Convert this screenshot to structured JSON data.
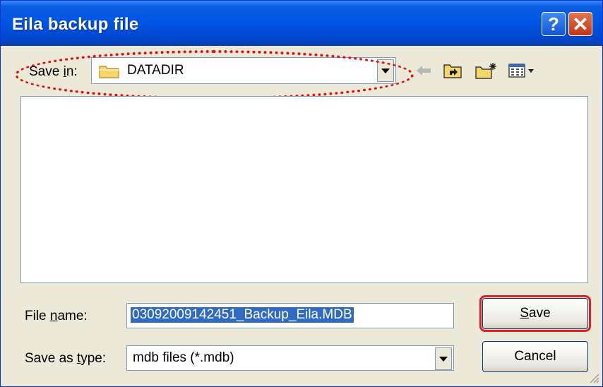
{
  "window": {
    "title": "Eila backup file",
    "help_label": "?",
    "close_label": "✕",
    "colors": {
      "titlebar": "#0055e5",
      "dialog": "#ece9d8",
      "highlight": "#e01010"
    }
  },
  "save_in": {
    "label_prefix": "Save ",
    "label_underline": "i",
    "label_suffix": "n:",
    "value": "DATADIR",
    "icon": "folder-icon"
  },
  "toolbar": {
    "items": [
      "back-arrow-icon",
      "up-folder-icon",
      "new-folder-icon",
      "view-menu-icon"
    ]
  },
  "file_name": {
    "label_prefix": "File ",
    "label_underline": "n",
    "label_suffix": "ame:",
    "value": "03092009142451_Backup_Eila.MDB"
  },
  "save_as_type": {
    "label_prefix": "Save as ",
    "label_underline": "t",
    "label_suffix": "ype:",
    "value": "mdb files (*.mdb)"
  },
  "buttons": {
    "save_underline": "S",
    "save_rest": "ave",
    "cancel": "Cancel"
  }
}
